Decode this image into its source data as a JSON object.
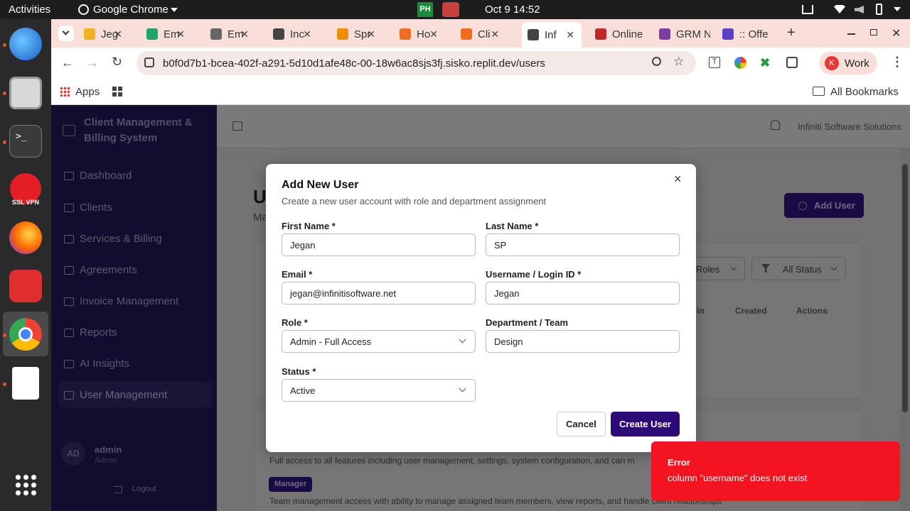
{
  "os": {
    "activities": "Activities",
    "app_name": "Google Chrome",
    "datetime": "Oct 9  14:52",
    "dock_vpn_label": "SSL VPN"
  },
  "browser": {
    "tabs": [
      {
        "label": "Jeg",
        "color": "#f2b21e"
      },
      {
        "label": "Em",
        "color": "#1fa463"
      },
      {
        "label": "Em",
        "color": "#666666"
      },
      {
        "label": "Inc",
        "color": "#444444"
      },
      {
        "label": "Spr",
        "color": "#f28c00"
      },
      {
        "label": "Ho",
        "color": "#f26b21"
      },
      {
        "label": "Cli",
        "color": "#f26b21"
      },
      {
        "label": "Inf",
        "color": "#444444",
        "active": true
      },
      {
        "label": "Online",
        "color": "#c0292c"
      },
      {
        "label": "GRM N",
        "color": "#7b3fa0"
      },
      {
        "label": ":: Offe",
        "color": "#5b3fc4"
      }
    ],
    "url": "b0f0d7b1-bcea-402f-a291-5d10d1afe48c-00-18w6ac8sjs3fj.sisko.replit.dev/users",
    "profile_initial": "K",
    "profile_name": "Work",
    "apps_label": "Apps",
    "all_bookmarks": "All Bookmarks"
  },
  "app": {
    "title_line1": "Client Management &",
    "title_line2": "Billing System",
    "nav": [
      "Dashboard",
      "Clients",
      "Services & Billing",
      "Agreements",
      "Invoice Management",
      "Reports",
      "AI Insights",
      "User Management"
    ],
    "user_initials": "AD",
    "user_name": "admin",
    "user_role": "Admin",
    "logout": "Logout",
    "company": "Infiniti Software Solutions",
    "page_title_letter": "U",
    "page_sub_letters": "Ma",
    "add_user": "Add User",
    "filter_roles": "Roles",
    "filter_status": "All Status",
    "col_login": "in",
    "col_created": "Created",
    "col_actions": "Actions",
    "admin_desc": "Full access to all features including user management, settings, system configuration, and can m",
    "manager_badge": "Manager",
    "manager_desc": "Team management access with ability to manage assigned team members, view reports, and handle client relationships"
  },
  "modal": {
    "title": "Add New User",
    "subtitle": "Create a new user account with role and department assignment",
    "first_name_label": "First Name *",
    "first_name": "Jegan",
    "last_name_label": "Last Name *",
    "last_name": "SP",
    "email_label": "Email *",
    "email": "jegan@infinitisoftware.net",
    "username_label": "Username / Login ID *",
    "username": "Jegan",
    "role_label": "Role *",
    "role": "Admin - Full Access",
    "department_label": "Department / Team",
    "department": "Design",
    "status_label": "Status *",
    "status": "Active",
    "cancel": "Cancel",
    "create": "Create User",
    "close": "×"
  },
  "toast": {
    "title": "Error",
    "message": "column \"username\" does not exist"
  },
  "colors": {
    "primary": "#2d0a7a",
    "error": "#f4141f"
  }
}
